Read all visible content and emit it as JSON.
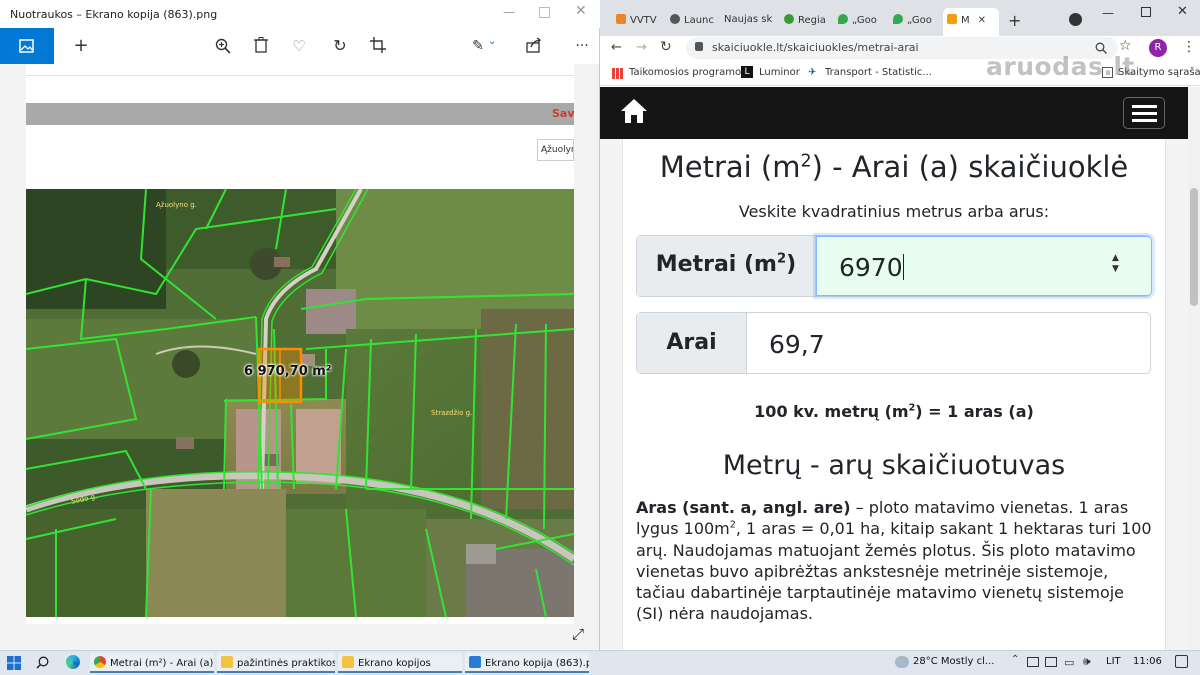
{
  "photos": {
    "title": "Nuotraukos – Ekrano kopija (863).png",
    "doc_bar_text": "Sav",
    "select_value": "Ąžuolyne",
    "map_area_label": "6 970,70 m²",
    "map_road_labels": [
      "Ąžuolyno g.",
      "Strazdžio g.",
      "Sodo g."
    ]
  },
  "browser": {
    "tabs": [
      "VVTV",
      "Launc",
      "Naujas sk",
      "Regia",
      "„Goo",
      "„Goo",
      "M"
    ],
    "url": "skaiciuokle.lt/skaiciuokles/metrai-arai",
    "profile_initial": "R",
    "bookmarks": [
      "Taikomosios programos",
      "Luminor",
      "Transport - Statistic...",
      "Skaitymo sąrašas"
    ]
  },
  "watermark": "aruodas.lt",
  "page": {
    "title_pre": "Metrai (m",
    "title_sup": "2",
    "title_post": ") - Arai (a) skaičiuoklė",
    "subtitle": "Veskite kvadratinius metrus arba arus:",
    "metrai_label_pre": "Metrai (m",
    "metrai_label_sup": "2",
    "metrai_label_post": ")",
    "metrai_value": "6970",
    "arai_label": "Arai",
    "arai_value": "69,7",
    "equation_pre": "100 kv. metrų (m",
    "equation_sup": "2",
    "equation_post": ") = 1 aras (a)",
    "h2": "Metrų - arų skaičiuotuvas",
    "para_bold": "Aras (sant. a, angl. are)",
    "para_1": " – ploto matavimo vienetas. 1 aras lygus 100m",
    "para_sup": "2",
    "para_2": ", 1 aras = 0,01 ha, kitaip sakant 1 hektaras turi 100 arų. Naudojamas matuojant žemės plotus. Šis ploto matavimo vienetas buvo apibrėžtas ankstesnėje metrinėje sistemoje, tačiau dabartinėje tarptautinėje matavimo vienetų sistemoje (SI) nėra naudojamas."
  },
  "taskbar": {
    "apps": [
      "Metrai (m²) - Arai (a) |...",
      "pažintinės praktikos u...",
      "Ekrano kopijos",
      "Ekrano kopija (863).p..."
    ],
    "weather": "28°C  Mostly cl...",
    "lang": "LIT",
    "time": "11:06"
  }
}
